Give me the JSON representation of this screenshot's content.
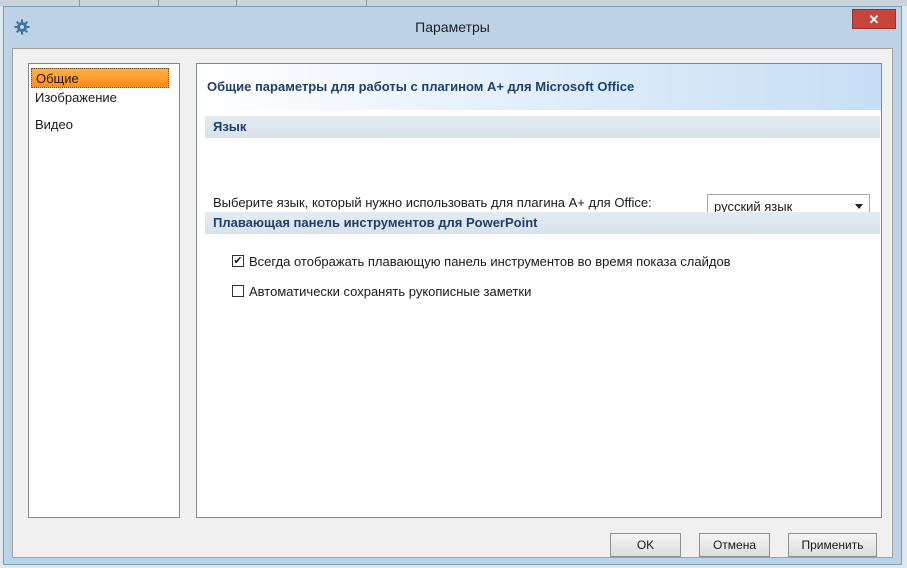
{
  "window": {
    "title": "Параметры",
    "close_symbol": "✕"
  },
  "nav": {
    "items": [
      "Общие",
      "Изображение",
      "Видео"
    ],
    "selected": "Общие"
  },
  "content": {
    "header": "Общие параметры для работы с плагином A+ для Microsoft Office",
    "language_section": {
      "title": "Язык",
      "label": "Выберите язык, который нужно использовать для плагина A+ для Office:",
      "selected_value": "русский язык"
    },
    "toolbar_section": {
      "title": "Плавающая панель инструментов для PowerPoint",
      "options": [
        {
          "label": "Всегда отображать плавающую панель инструментов во время показа слайдов",
          "checked": true
        },
        {
          "label": "Автоматически сохранять рукописные заметки",
          "checked": false
        }
      ]
    }
  },
  "buttons": {
    "ok": "OK",
    "cancel": "Отмена",
    "apply": "Применить"
  },
  "colors": {
    "selected_nav": "#ff9a28",
    "header_text": "#1f3f6a",
    "close_button": "#c7453a"
  },
  "icons": {
    "app": "gear-icon",
    "close": "close-icon",
    "dropdown": "chevron-down-icon"
  }
}
